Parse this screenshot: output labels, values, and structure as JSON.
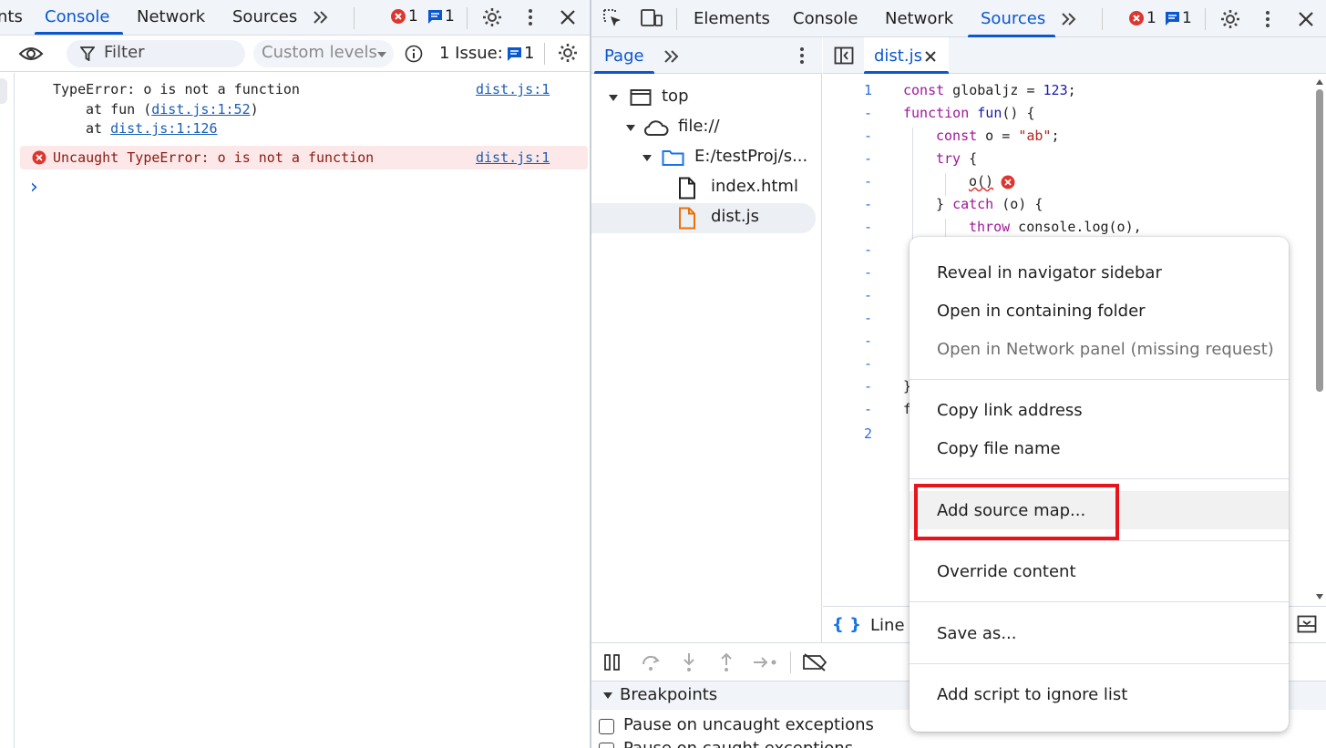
{
  "console_panel": {
    "tabs": [
      "nts",
      "Console",
      "Network",
      "Sources"
    ],
    "more_tabs_icon": "chevron-double-right-icon",
    "error_count": "1",
    "message_count": "1",
    "toolbar": {
      "filter_placeholder": "Filter",
      "levels_label": "Custom levels",
      "issues_label": "1 Issue:",
      "issues_count": "1"
    },
    "messages": {
      "first_line": "TypeError: o is not a function",
      "first_source": "dist.js:1",
      "stack_at_1": "at fun (",
      "stack_link_1": "dist.js:1:52",
      "stack_close_1": ")",
      "stack_at_2": "at ",
      "stack_link_2": "dist.js:1:126",
      "error_text": "Uncaught TypeError: o is not a function",
      "error_source": "dist.js:1"
    },
    "prompt_symbol": "›"
  },
  "sources_panel": {
    "tabs": [
      "Elements",
      "Console",
      "Network",
      "Sources"
    ],
    "error_count": "1",
    "message_count": "1",
    "navigator": {
      "tab": "Page",
      "tree": {
        "top": "top",
        "file": "file://",
        "folder": "E:/testProj/s...",
        "file1": "index.html",
        "file2": "dist.js"
      }
    },
    "editor": {
      "tab": "dist.js",
      "line_numbers": [
        "1",
        "-",
        "-",
        "-",
        "-",
        "-",
        "-",
        "-",
        "-",
        "-",
        "-",
        "-",
        "-",
        "-",
        "-",
        "2"
      ],
      "code": {
        "l1_kw": "const",
        "l1_rest": " globaljz = ",
        "l1_num": "123",
        "l1_end": ";",
        "l2_kw": "function",
        "l2_fn": " fun",
        "l2_end": "() {",
        "l3_kw": "const",
        "l3_rest": " o = ",
        "l3_str": "\"ab\"",
        "l3_end": ";",
        "l4_kw": "try",
        "l4_end": " {",
        "l5": "o()",
        "l6_open": "} ",
        "l6_kw": "catch",
        "l6_end": " (o) {",
        "l7_kw": "throw",
        "l7_rest": " console.log(o),",
        "l14": "}",
        "l15": "f"
      },
      "status_line": "Line"
    },
    "breakpoints_header": "Breakpoints",
    "pause_uncaught": "Pause on uncaught exceptions",
    "pause_caught": "Pause on caught exceptions"
  },
  "context_menu": {
    "items": [
      "Reveal in navigator sidebar",
      "Open in containing folder",
      "Open in Network panel (missing request)",
      "Copy link address",
      "Copy file name",
      "Add source map...",
      "Override content",
      "Save as...",
      "Add script to ignore list"
    ]
  },
  "colors": {
    "accent": "#0b57d0",
    "error": "#dc362e",
    "highlight_box": "#e8141b"
  }
}
